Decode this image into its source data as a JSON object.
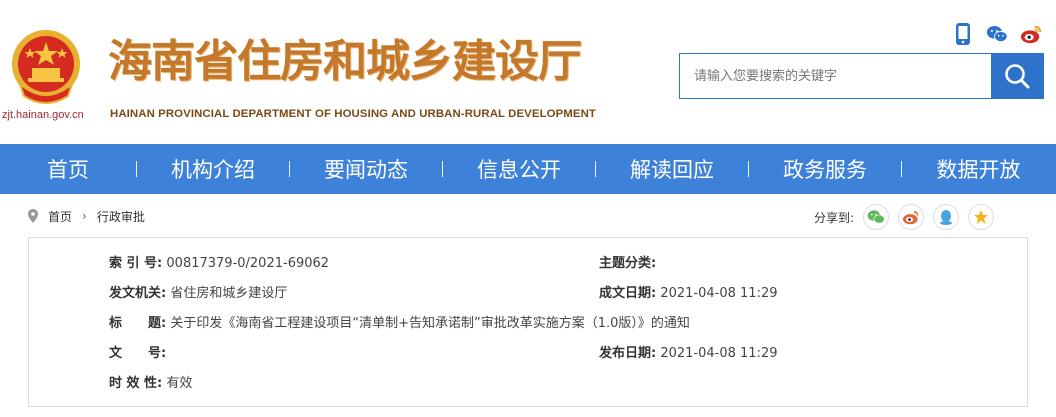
{
  "site": {
    "domain": "zjt.hainan.gov.cn",
    "title_cn": "海南省住房和城乡建设厅",
    "title_en": "HAINAN PROVINCIAL DEPARTMENT OF HOUSING AND URBAN-RURAL DEVELOPMENT"
  },
  "header": {
    "social_icons": [
      "mobile-icon",
      "wechat-icon",
      "weibo-icon"
    ],
    "search": {
      "placeholder": "请输入您要搜索的关键字",
      "value": ""
    }
  },
  "nav": {
    "items": [
      "首页",
      "机构介绍",
      "要闻动态",
      "信息公开",
      "解读回应",
      "政务服务",
      "数据开放"
    ]
  },
  "breadcrumb": {
    "items": [
      "首页",
      "行政审批"
    ]
  },
  "share": {
    "label": "分享到:",
    "targets": [
      "wechat-share-icon",
      "weibo-share-icon",
      "qq-share-icon",
      "qzone-share-icon"
    ]
  },
  "info": {
    "index_label": "索 引 号:",
    "index_value": "00817379-0/2021-69062",
    "subject_label": "主题分类:",
    "subject_value": "",
    "issuer_label": "发文机关:",
    "issuer_value": "省住房和城乡建设厅",
    "date_written_label": "成文日期:",
    "date_written_value": "2021-04-08 11:29",
    "title_label": "标　　题:",
    "title_value": "关于印发《海南省工程建设项目“清单制+告知承诺制”审批改革实施方案（1.0版）》的通知",
    "docno_label": "文　　号:",
    "docno_value": "",
    "publish_label": "发布日期:",
    "publish_value": "2021-04-08 11:29",
    "validity_label": "时 效 性:",
    "validity_value": "有效"
  },
  "colors": {
    "nav_bg": "#3d82d8",
    "brand_orange": "#c4782c",
    "search_blue": "#2f72c9"
  }
}
